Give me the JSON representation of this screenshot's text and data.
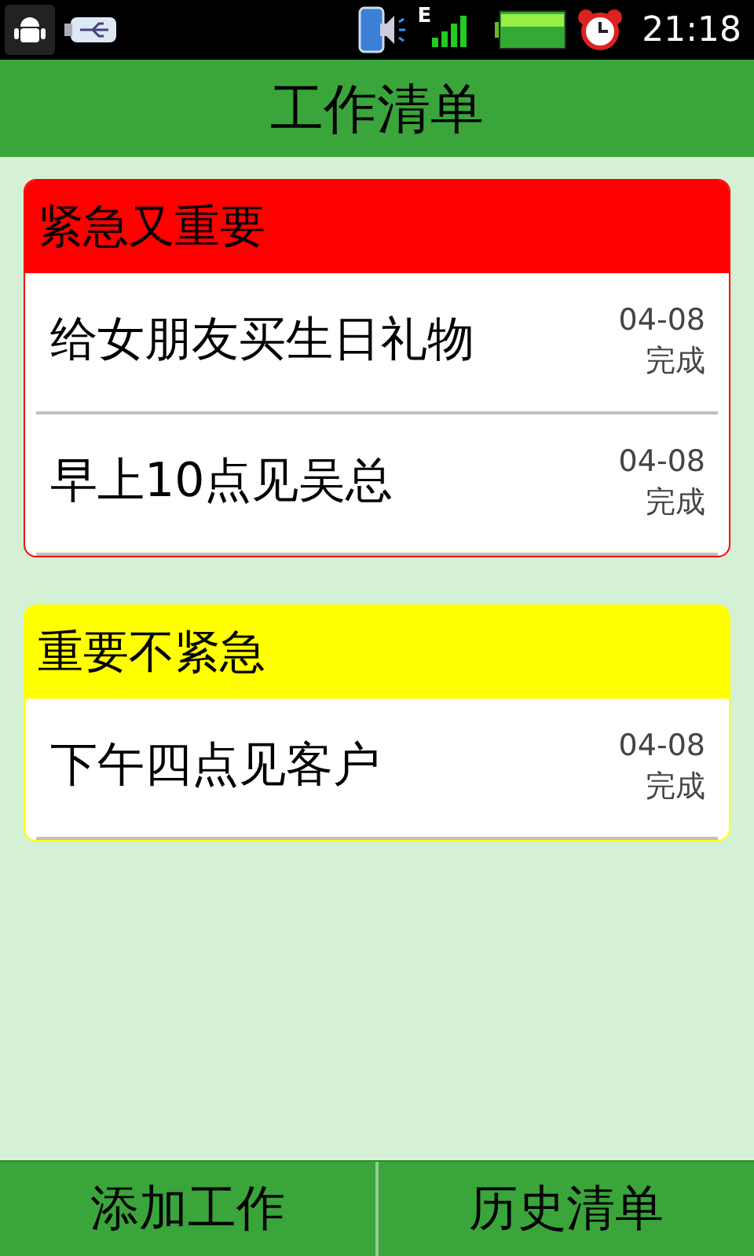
{
  "status_bar": {
    "network_type": "E",
    "time": "21:18"
  },
  "title": "工作清单",
  "groups": [
    {
      "title": "紧急又重要",
      "color": "#ff0000",
      "tasks": [
        {
          "name": "给女朋友买生日礼物",
          "date": "04-08",
          "status": "完成"
        },
        {
          "name": "早上10点见吴总",
          "date": "04-08",
          "status": "完成"
        }
      ]
    },
    {
      "title": "重要不紧急",
      "color": "#ffff00",
      "tasks": [
        {
          "name": "下午四点见客户",
          "date": "04-08",
          "status": "完成"
        }
      ]
    }
  ],
  "buttons": [
    "添加工作",
    "历史清单"
  ]
}
